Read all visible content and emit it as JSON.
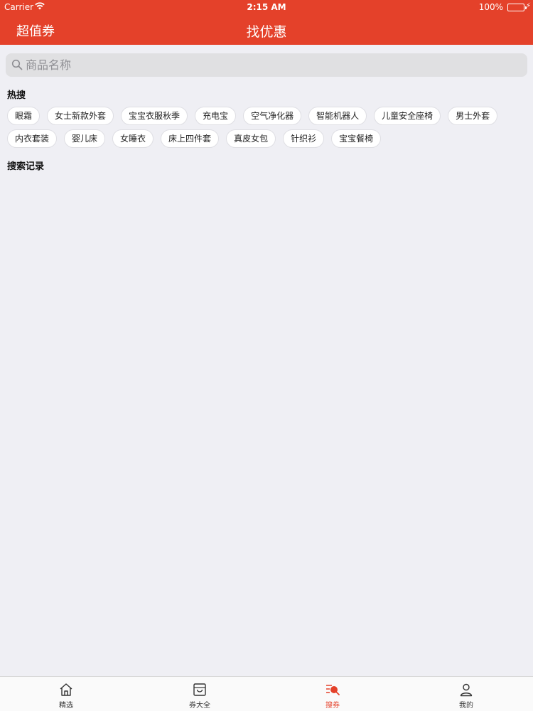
{
  "status_bar": {
    "carrier": "Carrier",
    "time": "2:15 AM",
    "battery": "100%",
    "battery_level": 1.0
  },
  "navbar": {
    "left_label": "超值券",
    "title": "找优惠"
  },
  "search": {
    "placeholder": "商品名称",
    "value": ""
  },
  "hot_search": {
    "title": "热搜",
    "tags": [
      "眼霜",
      "女士新款外套",
      "宝宝衣服秋季",
      "充电宝",
      "空气净化器",
      "智能机器人",
      "儿童安全座椅",
      "男士外套",
      "内衣套装",
      "婴儿床",
      "女睡衣",
      "床上四件套",
      "真皮女包",
      "针织衫",
      "宝宝餐椅"
    ]
  },
  "history": {
    "title": "搜索记录"
  },
  "tabbar": {
    "items": [
      {
        "label": "精选",
        "icon": "home-icon"
      },
      {
        "label": "券大全",
        "icon": "coupon-box-icon"
      },
      {
        "label": "搜券",
        "icon": "search-coupon-icon"
      },
      {
        "label": "我的",
        "icon": "user-icon"
      }
    ],
    "active": "搜券"
  },
  "colors": {
    "brand": "#e4412a",
    "background": "#efeff4",
    "battery": "#4cd964"
  }
}
